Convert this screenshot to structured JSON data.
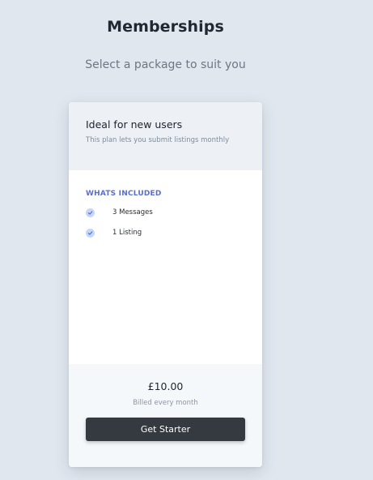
{
  "page": {
    "title": "Memberships",
    "subtitle": "Select a package to suit you"
  },
  "plan": {
    "name": "Ideal for new users",
    "description": "This plan lets you submit listings monthly",
    "included_label": "WHATS INCLUDED",
    "features": [
      {
        "label": "3 Messages",
        "icon": "check-circle-icon"
      },
      {
        "label": "1 Listing",
        "icon": "check-circle-icon"
      }
    ],
    "price": "£10.00",
    "billing": "Billed every month",
    "cta_label": "Get Starter"
  },
  "colors": {
    "background": "#e1e7ef",
    "accent": "#5a6fd1",
    "button": "#343a40"
  }
}
